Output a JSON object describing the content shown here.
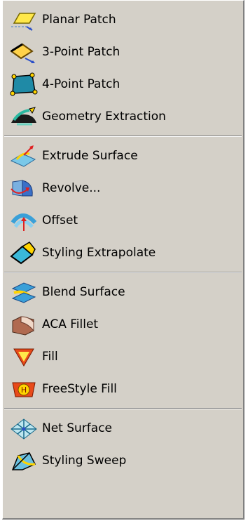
{
  "menu": {
    "groups": [
      {
        "items": [
          {
            "label": "Planar Patch",
            "icon": "planar-patch-icon"
          },
          {
            "label": "3-Point Patch",
            "icon": "three-point-patch-icon"
          },
          {
            "label": "4-Point Patch",
            "icon": "four-point-patch-icon"
          },
          {
            "label": "Geometry Extraction",
            "icon": "geometry-extraction-icon"
          }
        ]
      },
      {
        "items": [
          {
            "label": "Extrude Surface",
            "icon": "extrude-surface-icon"
          },
          {
            "label": "Revolve...",
            "icon": "revolve-icon"
          },
          {
            "label": "Offset",
            "icon": "offset-icon"
          },
          {
            "label": "Styling Extrapolate",
            "icon": "styling-extrapolate-icon"
          }
        ]
      },
      {
        "items": [
          {
            "label": "Blend Surface",
            "icon": "blend-surface-icon"
          },
          {
            "label": "ACA Fillet",
            "icon": "aca-fillet-icon"
          },
          {
            "label": "Fill",
            "icon": "fill-icon"
          },
          {
            "label": "FreeStyle Fill",
            "icon": "freestyle-fill-icon"
          }
        ]
      },
      {
        "items": [
          {
            "label": "Net Surface",
            "icon": "net-surface-icon"
          },
          {
            "label": "Styling Sweep",
            "icon": "styling-sweep-icon"
          }
        ]
      }
    ],
    "colors": {
      "background": "#d4d0c8",
      "separator_dark": "#808080",
      "separator_light": "#ffffff",
      "text": "#000000"
    }
  }
}
